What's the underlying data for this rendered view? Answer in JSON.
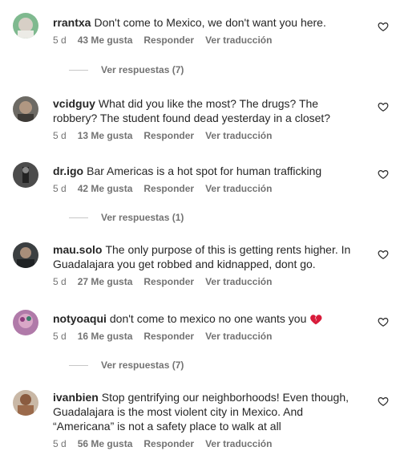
{
  "comments": [
    {
      "username": "rrantxa",
      "text": "Don't come to Mexico, we don't want you here.",
      "time": "5 d",
      "likes": "43 Me gusta",
      "reply": "Responder",
      "translate": "Ver traducción",
      "replies": "Ver respuestas (7)"
    },
    {
      "username": "vcidguy",
      "text": "What did you like the most? The drugs? The robbery? The student found dead yesterday in a closet?",
      "time": "5 d",
      "likes": "13 Me gusta",
      "reply": "Responder",
      "translate": "Ver traducción"
    },
    {
      "username": "dr.igo",
      "text": "Bar Americas is a hot spot for human trafficking",
      "time": "5 d",
      "likes": "42 Me gusta",
      "reply": "Responder",
      "translate": "Ver traducción",
      "replies": "Ver respuestas (1)"
    },
    {
      "username": "mau.solo",
      "text": "The only purpose of this is getting rents higher. In Guadalajara you get robbed and kidnapped, dont go.",
      "time": "5 d",
      "likes": "27 Me gusta",
      "reply": "Responder",
      "translate": "Ver traducción"
    },
    {
      "username": "notyoaqui",
      "text": "don't come to mexico no one wants you",
      "time": "5 d",
      "likes": "16 Me gusta",
      "reply": "Responder",
      "translate": "Ver traducción",
      "replies": "Ver respuestas (7)"
    },
    {
      "username": "ivanbien",
      "text": "Stop gentrifying our neighborhoods! Even though, Guadalajara is the most violent city in Mexico. And “Americana” is not a safety place to walk at all",
      "time": "5 d",
      "likes": "56 Me gusta",
      "reply": "Responder",
      "translate": "Ver traducción"
    }
  ],
  "colors": {
    "text": "#262626",
    "muted": "#737373",
    "heart_emoji": "#d81b3a"
  },
  "icons": {
    "like": "heart-outline-icon",
    "emoji": "broken-heart-emoji"
  }
}
